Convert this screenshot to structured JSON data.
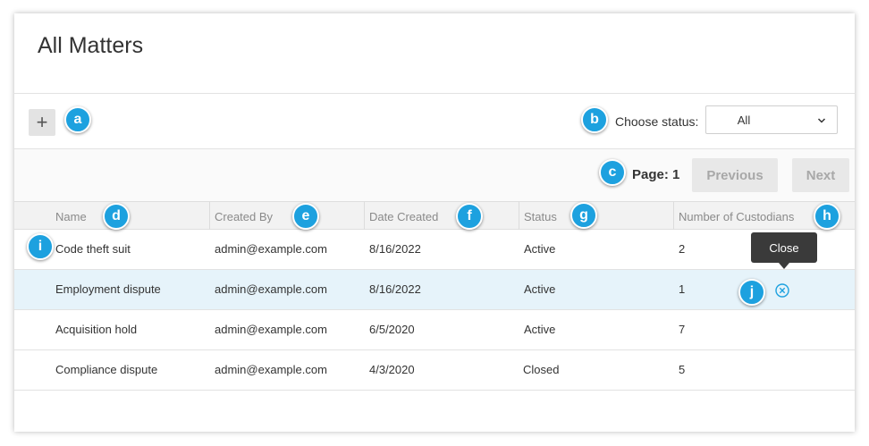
{
  "page": {
    "title": "All Matters"
  },
  "toolbar": {
    "add_label": "+",
    "status_label": "Choose status:",
    "status_value": "All"
  },
  "pager": {
    "page_label": "Page: 1",
    "previous_label": "Previous",
    "next_label": "Next"
  },
  "table": {
    "columns": [
      "Name",
      "Created By",
      "Date Created",
      "Status",
      "Number of Custodians"
    ],
    "rows": [
      [
        "Code theft suit",
        "admin@example.com",
        "8/16/2022",
        "Active",
        "2"
      ],
      [
        "Employment dispute",
        "admin@example.com",
        "8/16/2022",
        "Active",
        "1"
      ],
      [
        "Acquisition hold",
        "admin@example.com",
        "6/5/2020",
        "Active",
        "7"
      ],
      [
        "Compliance dispute",
        "admin@example.com",
        "4/3/2020",
        "Closed",
        "5"
      ]
    ]
  },
  "tooltip": {
    "text": "Close"
  },
  "callouts": [
    "a",
    "b",
    "c",
    "d",
    "e",
    "f",
    "g",
    "h",
    "i",
    "j"
  ],
  "colors": {
    "callout": "#1da1df",
    "selected_row": "#e6f3fa",
    "close_icon": "#1da1df"
  }
}
